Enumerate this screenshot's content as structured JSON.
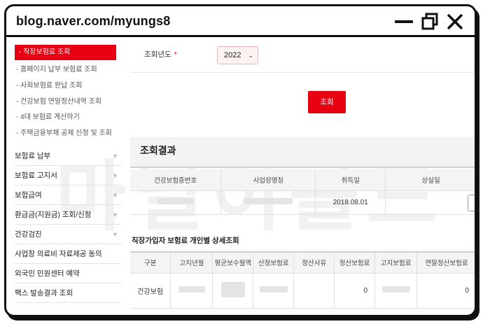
{
  "browser": {
    "url": "blog.naver.com/myungs8"
  },
  "sidebar": {
    "active_sub": "- 직장보험료 조회",
    "sub_items": [
      "- 홈페이지 납부 보험료 조회",
      "- 사회보험료 완납 조회",
      "- 건강보험 연말정산내역 조회",
      "- 4대 보험료 계산하기",
      "- 주택금융부채 공제 신청 및 조회"
    ],
    "menus": [
      "보험료 납부",
      "보험료 고지서",
      "보험급여",
      "환급금(지원금) 조회/신청",
      "건강검진",
      "사업장 의료비 자료제공 동의",
      "외국인 민원센터 예약",
      "팩스 발송결과 조회"
    ]
  },
  "filter": {
    "year_label": "조회년도",
    "required_mark": "*",
    "year_value": "2022"
  },
  "search_button": "조회",
  "result": {
    "title": "조회결과",
    "columns": [
      "건강보험증번호",
      "사업장명칭",
      "취득일",
      "상실일"
    ],
    "row": {
      "acquired_date": "2018.08.01"
    }
  },
  "detail": {
    "title": "직장가입자 보험료 개인별 상세조회",
    "columns": [
      "구분",
      "고지년월",
      "평균보수월액",
      "산정보험료",
      "정산사유",
      "정산보험료",
      "고지보험료",
      "연말정산보험료"
    ],
    "row": {
      "category": "건강보험",
      "settlement_premium": "0",
      "year_end_premium": "0"
    }
  },
  "watermark": "마닐이를드"
}
